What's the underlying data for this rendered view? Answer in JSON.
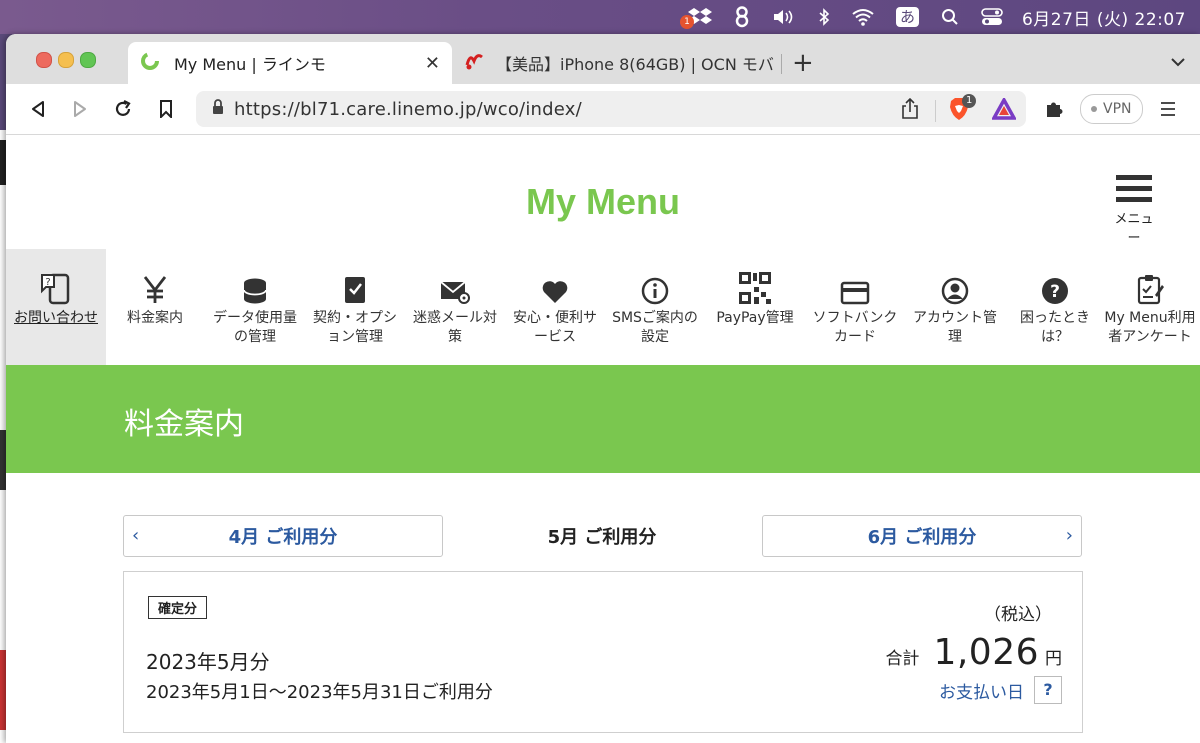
{
  "menubar": {
    "notification_count": "1",
    "input_method": "あ",
    "clock": "6月27日 (火)  22:07"
  },
  "tabs": [
    {
      "title": "My Menu | ラインモ",
      "active": true
    },
    {
      "title": "【美品】iPhone 8(64GB) | OCN モバ",
      "active": false
    }
  ],
  "toolbar": {
    "url": "https://bl71.care.linemo.jp/wco/index/",
    "brave_badge": "1",
    "vpn_label": "VPN"
  },
  "site": {
    "title": "My Menu",
    "menu_label": "メニュー",
    "accent_color": "#7ac74f"
  },
  "nav": [
    {
      "label": "お問い合わせ",
      "icon": "phone-question-icon"
    },
    {
      "label": "料金案内",
      "icon": "yen-icon"
    },
    {
      "label": "データ使用量の管理",
      "icon": "database-icon"
    },
    {
      "label": "契約・オプション管理",
      "icon": "clipboard-check-icon"
    },
    {
      "label": "迷惑メール対策",
      "icon": "mail-settings-icon"
    },
    {
      "label": "安心・便利サービス",
      "icon": "heart-icon"
    },
    {
      "label": "SMSご案内の設定",
      "icon": "info-icon"
    },
    {
      "label": "PayPay管理",
      "icon": "qr-code-icon"
    },
    {
      "label": "ソフトバンクカード",
      "icon": "card-icon"
    },
    {
      "label": "アカウント管理",
      "icon": "user-icon"
    },
    {
      "label": "困ったときは？",
      "icon": "help-icon"
    },
    {
      "label": "My Menu利用者アンケート",
      "icon": "survey-icon"
    }
  ],
  "section_title": "料金案内",
  "months": {
    "prev": "4月 ご利用分",
    "current": "5月 ご利用分",
    "next": "6月 ご利用分"
  },
  "bill": {
    "status": "確定分",
    "month": "2023年5月分",
    "range": "2023年5月1日〜2023年5月31日ご利用分",
    "tax_note": "（税込）",
    "total_label": "合計",
    "total_value": "1,026",
    "currency": "円",
    "pay_date_link": "お支払い日",
    "help": "?"
  }
}
